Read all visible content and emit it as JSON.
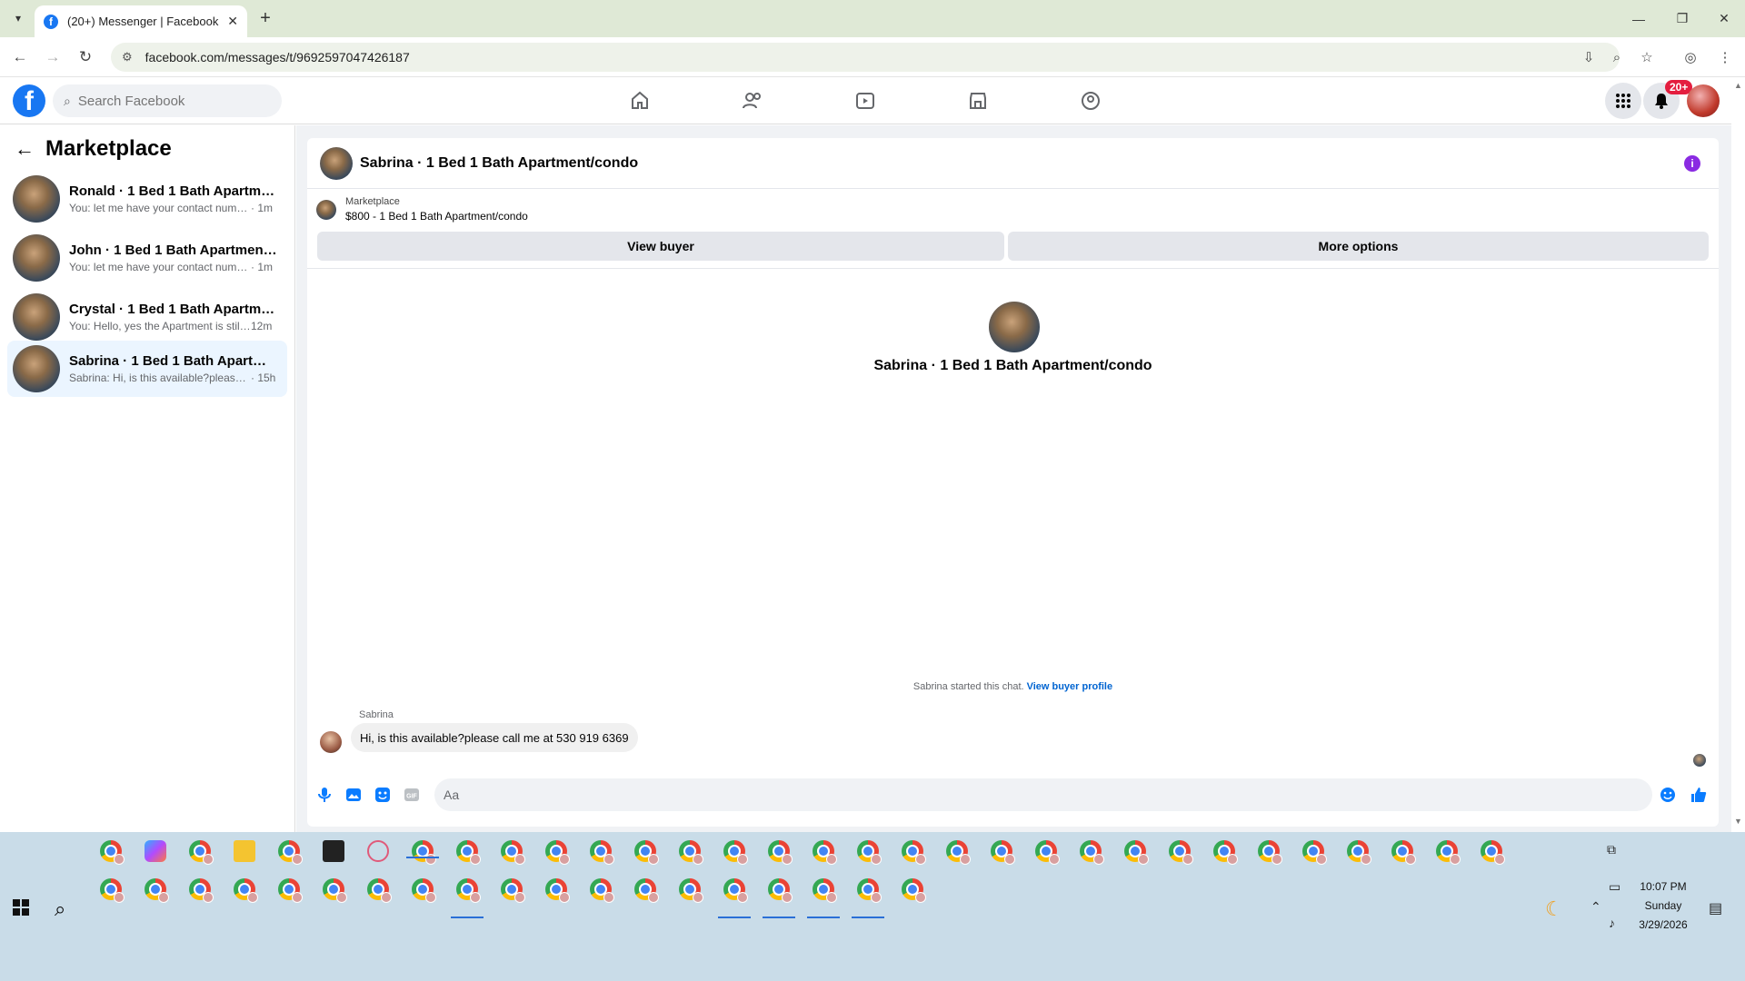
{
  "browser": {
    "tab_title": "(20+) Messenger | Facebook",
    "url": "facebook.com/messages/t/9692597047426187",
    "accent": "#dfe9d6"
  },
  "facebook": {
    "search_placeholder": "Search Facebook",
    "notification_badge": "20+",
    "brand_color": "#1877f2"
  },
  "sidebar": {
    "title": "Marketplace",
    "conversations": [
      {
        "name": "Ronald · 1 Bed 1 Bath Apartment/c...",
        "preview": "You: let me have your contact numbe...",
        "time": "· 1m"
      },
      {
        "name": "John · 1 Bed 1 Bath Apartment/con...",
        "preview": "You: let me have your contact numbe...",
        "time": "· 1m"
      },
      {
        "name": "Crystal · 1 Bed 1 Bath Apartment/c...",
        "preview": "You: Hello, yes the Apartment is still ...",
        "time": "12m"
      },
      {
        "name": "Sabrina · 1 Bed 1 Bath Apartment/c...",
        "preview": "Sabrina: Hi, is this available?please c...",
        "time": "· 15h"
      }
    ]
  },
  "chat": {
    "title": "Sabrina · 1 Bed 1 Bath Apartment/condo",
    "listing_label": "Marketplace",
    "listing_price_title": "$800 - 1 Bed 1 Bath Apartment/condo",
    "view_buyer_label": "View buyer",
    "more_options_label": "More options",
    "center_name": "Sabrina · 1 Bed 1 Bath Apartment/condo",
    "started_text": "Sabrina started this chat.",
    "view_buyer_profile_label": "View buyer profile",
    "sender_name": "Sabrina",
    "message": "Hi, is this available?please call me at 530 919 6369",
    "composer_placeholder": "Aa"
  },
  "taskbar": {
    "time": "10:07 PM",
    "day": "Sunday",
    "date": "3/29/2026"
  }
}
